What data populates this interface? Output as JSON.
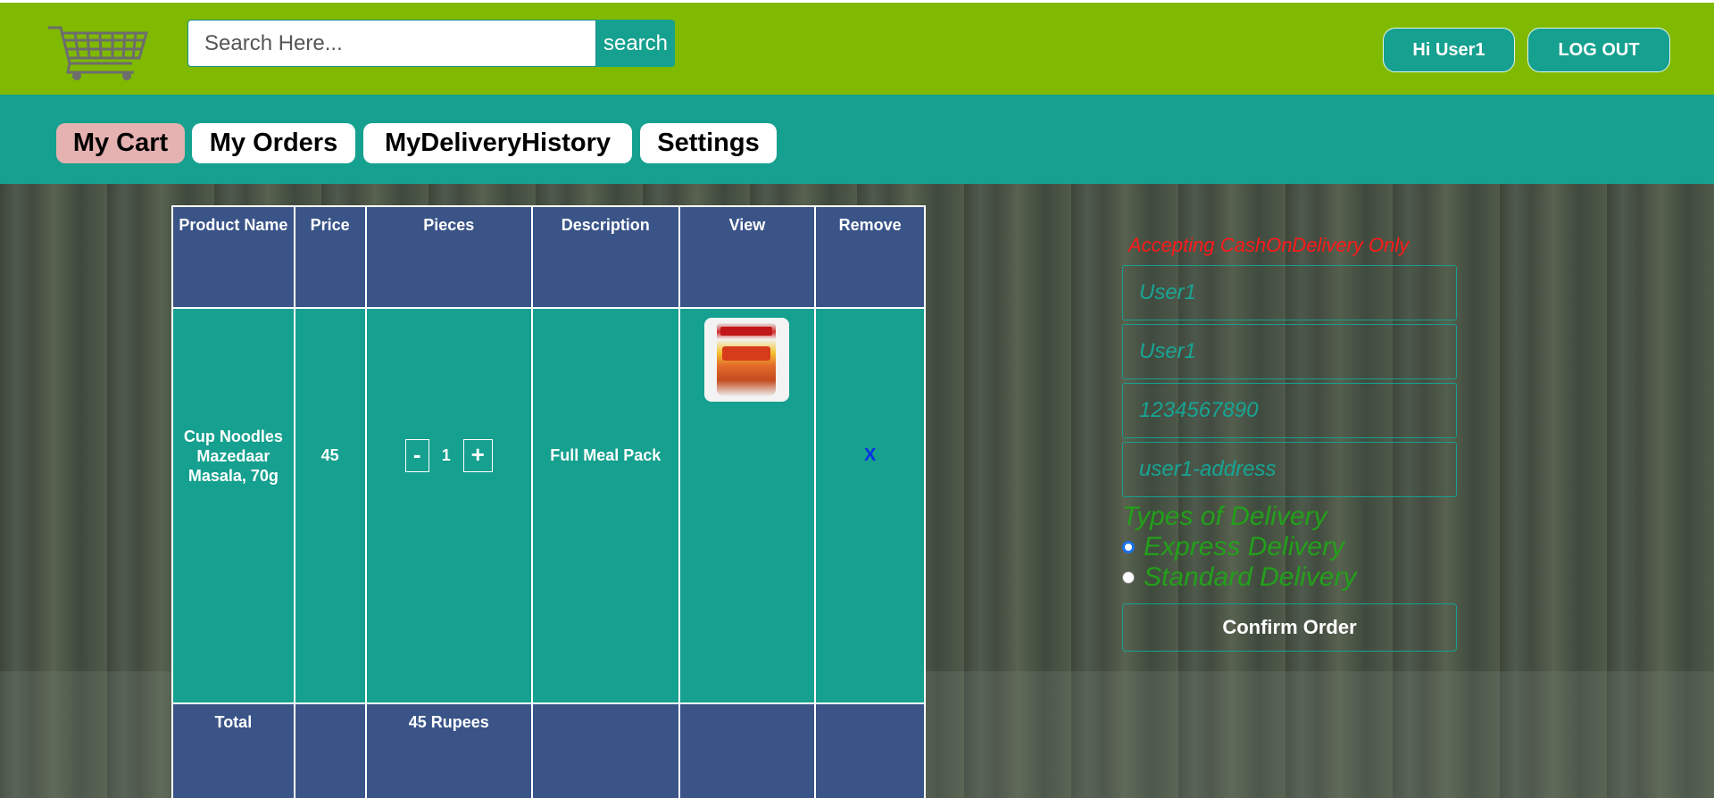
{
  "header": {
    "search_placeholder": "Search Here...",
    "search_button": "search",
    "greeting_button": "Hi User1",
    "logout_button": "LOG OUT"
  },
  "nav": {
    "tabs": [
      {
        "label": "My Cart",
        "active": true
      },
      {
        "label": "My Orders",
        "active": false
      },
      {
        "label": "MyDeliveryHistory",
        "active": false
      },
      {
        "label": "Settings",
        "active": false
      }
    ]
  },
  "cart_table": {
    "headers": [
      "Product Name",
      "Price",
      "Pieces",
      "Description",
      "View",
      "Remove"
    ],
    "rows": [
      {
        "product_name": "Cup Noodles Mazedaar Masala, 70g",
        "price": "45",
        "minus": "-",
        "quantity": "1",
        "plus": "+",
        "description": "Full Meal Pack",
        "remove": "X"
      }
    ],
    "footer": {
      "label": "Total",
      "total": "45 Rupees"
    }
  },
  "order_form": {
    "cod_note": "Accepting CashOnDelivery Only",
    "fields": [
      {
        "value": "User1"
      },
      {
        "value": "User1"
      },
      {
        "value": "1234567890"
      },
      {
        "value": "user1-address"
      }
    ],
    "delivery_title": "Types of Delivery",
    "delivery_options": [
      {
        "label": "Express Delivery",
        "checked": true
      },
      {
        "label": "Standard Delivery",
        "checked": false
      }
    ],
    "confirm_button": "Confirm Order"
  },
  "colors": {
    "header_bg": "#7fb900",
    "nav_bg": "#16a08f",
    "active_tab": "#e6b1b1",
    "table_header_bg": "#3a5488",
    "table_row_bg": "#16a08f",
    "cod_note": "#ff1a1a",
    "delivery_text": "#22a01a"
  }
}
